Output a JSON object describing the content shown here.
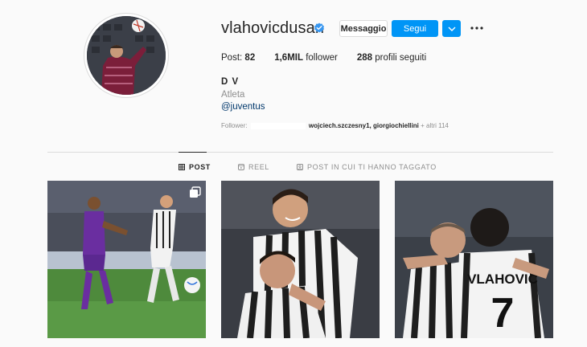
{
  "profile": {
    "username": "vlahovicdusan",
    "verified": true,
    "buttons": {
      "message": "Messaggio",
      "follow": "Segui"
    },
    "stats": {
      "posts_label": "Post:",
      "posts_value": "82",
      "followers_value": "1,6MIL",
      "followers_label": "follower",
      "following_value": "288",
      "following_label": "profili seguiti"
    },
    "full_name": "D V",
    "category": "Atleta",
    "link": "@juventus",
    "followed_by": {
      "prefix": "Follower:",
      "names": "wojciech.szczesny1, giorgiochiellini",
      "suffix": "+ altri 114"
    }
  },
  "tabs": [
    {
      "label": "POST",
      "icon": "grid-icon",
      "active": true
    },
    {
      "label": "REEL",
      "icon": "reel-icon",
      "active": false
    },
    {
      "label": "POST IN CUI TI HANNO TAGGATO",
      "icon": "tagged-icon",
      "active": false
    }
  ],
  "posts": [
    {
      "icon": "multi-photo-icon"
    },
    {
      "icon": null
    },
    {
      "icon": null,
      "jersey_text": "VLAHOVIĆ",
      "jersey_number": "7"
    }
  ],
  "colors": {
    "accent": "#0095f6",
    "background": "#fafafa",
    "link": "#00376b",
    "border": "#dbdbdb",
    "muted": "#8e8e8e"
  }
}
